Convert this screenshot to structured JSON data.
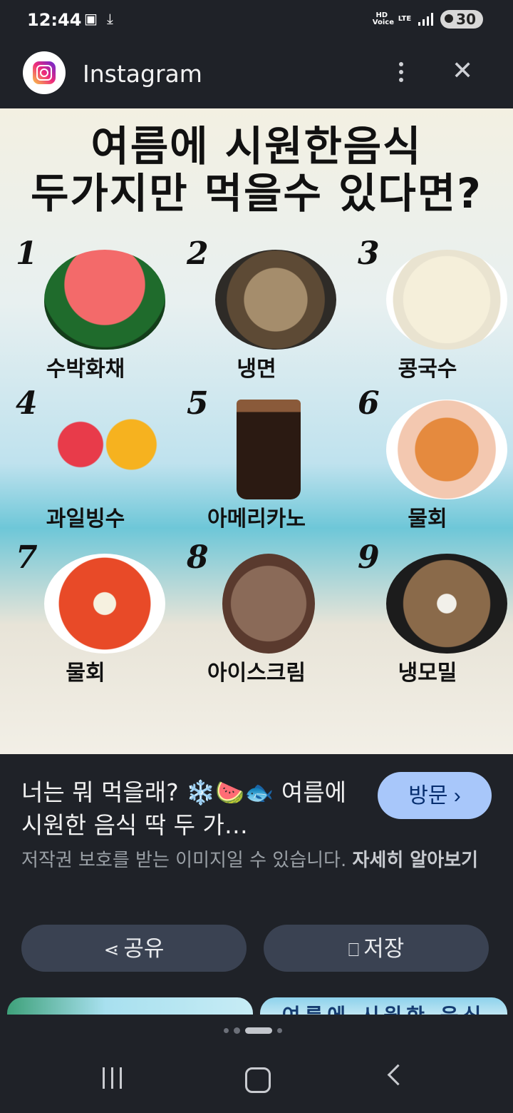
{
  "status_bar": {
    "time": "12:44",
    "network": "LTE",
    "voice": "HD Voice",
    "battery": "30"
  },
  "app_bar": {
    "title": "Instagram"
  },
  "image": {
    "title_line1": "여름에 시원한음식",
    "title_line2": "두가지만 먹을수 있다면?",
    "items": [
      {
        "num": "1",
        "name": "수박화채",
        "color": "#d93a3a"
      },
      {
        "num": "2",
        "name": "냉면",
        "color": "#6b5a45"
      },
      {
        "num": "3",
        "name": "콩국수",
        "color": "#f1ead2"
      },
      {
        "num": "4",
        "name": "과일빙수",
        "color": "#f4a12a"
      },
      {
        "num": "5",
        "name": "아메리카노",
        "color": "#3a2418"
      },
      {
        "num": "6",
        "name": "물회",
        "color": "#e6893f"
      },
      {
        "num": "7",
        "name": "물회",
        "color": "#e34a2a"
      },
      {
        "num": "8",
        "name": "아이스크림",
        "color": "#6b4a3a"
      },
      {
        "num": "9",
        "name": "냉모밀",
        "color": "#2a2a2a"
      }
    ]
  },
  "info": {
    "caption": "너는 뭐 먹을래? ❄️🍉🐟 여름에 시원한 음식 딱 두 가…",
    "visit_label": "방문 ›",
    "copyright_text": "저작권 보호를 받는 이미지일 수 있습니다.",
    "learn_more": "자세히 알아보기"
  },
  "actions": {
    "share_label": "공유",
    "save_label": "저장"
  },
  "thumbnails": {
    "second_title": "여름에 시원한 음식"
  }
}
